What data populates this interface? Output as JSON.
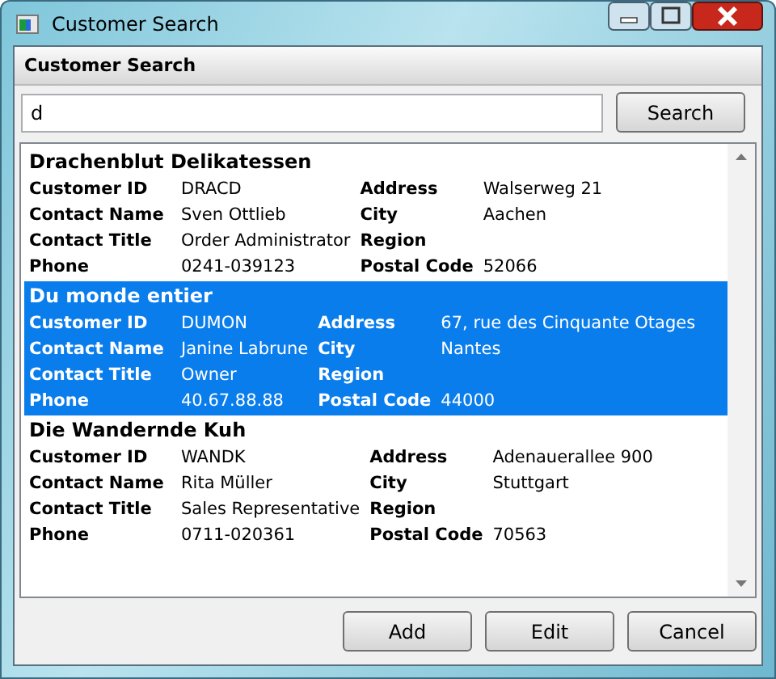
{
  "window": {
    "title": "Customer Search"
  },
  "panel": {
    "title": "Customer Search"
  },
  "search": {
    "value": "d",
    "button": "Search"
  },
  "customers": [
    {
      "name": "Drachenblut Delikatessen",
      "selected": false,
      "fields": [
        {
          "label": "Customer ID",
          "value": "DRACD"
        },
        {
          "label": "Address",
          "value": "Walserweg 21"
        },
        {
          "label": "Contact Name",
          "value": "Sven Ottlieb"
        },
        {
          "label": "City",
          "value": "Aachen"
        },
        {
          "label": "Contact Title",
          "value": "Order Administrator"
        },
        {
          "label": "Region"
        },
        {
          "label": "Phone",
          "value": "0241-039123"
        },
        {
          "label": "Postal Code",
          "value": "52066"
        }
      ]
    },
    {
      "name": "Du monde entier",
      "selected": true,
      "fields": [
        {
          "label": "Customer ID",
          "value": "DUMON"
        },
        {
          "label": "Address",
          "value": "67, rue des Cinquante Otages"
        },
        {
          "label": "Contact Name",
          "value": "Janine Labrune"
        },
        {
          "label": "City",
          "value": "Nantes"
        },
        {
          "label": "Contact Title",
          "value": "Owner"
        },
        {
          "label": "Region"
        },
        {
          "label": "Phone",
          "value": "40.67.88.88"
        },
        {
          "label": "Postal Code",
          "value": "44000"
        }
      ]
    },
    {
      "name": "Die Wandernde Kuh",
      "selected": false,
      "fields": [
        {
          "label": "Customer ID",
          "value": "WANDK"
        },
        {
          "label": "Address",
          "value": "Adenauerallee 900"
        },
        {
          "label": "Contact Name",
          "value": "Rita Müller"
        },
        {
          "label": "City",
          "value": "Stuttgart"
        },
        {
          "label": "Contact Title",
          "value": "Sales Representative"
        },
        {
          "label": "Region"
        },
        {
          "label": "Phone",
          "value": "0711-020361"
        },
        {
          "label": "Postal Code",
          "value": "70563"
        }
      ]
    }
  ],
  "buttons": [
    "Add",
    "Edit",
    "Cancel"
  ]
}
